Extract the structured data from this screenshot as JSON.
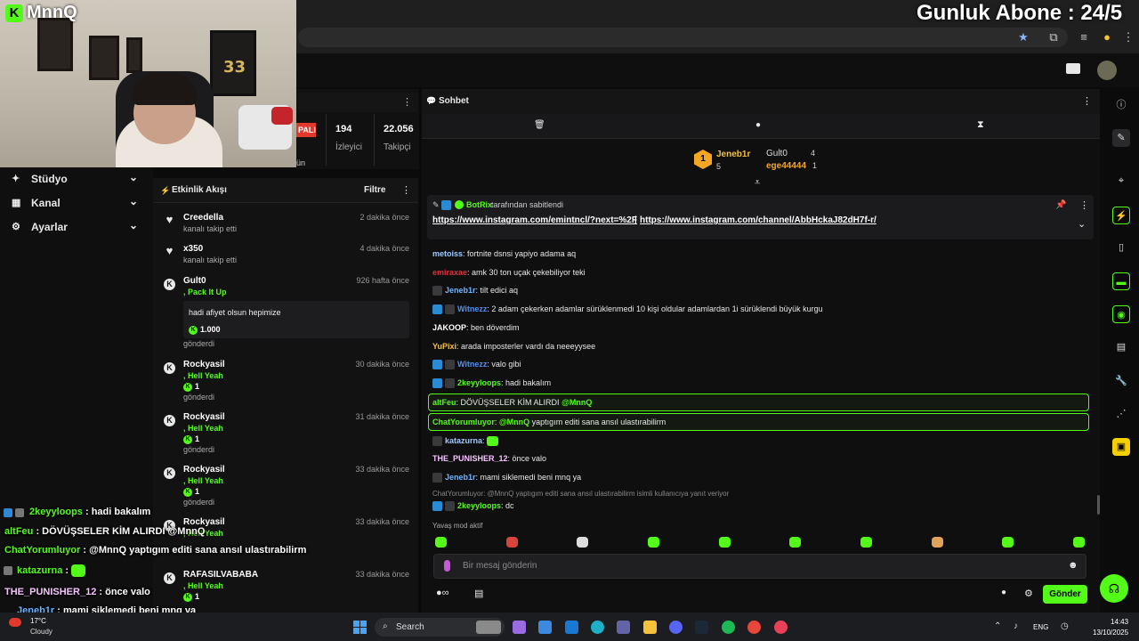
{
  "overlay": {
    "logo_letter": "K",
    "logo_text": "MnnQ",
    "daily_subs": "Gunluk Abone : 24/5",
    "jersey_number": "33"
  },
  "sidebar": {
    "items": [
      {
        "label": "Stüdyo"
      },
      {
        "label": "Kanal"
      },
      {
        "label": "Ayarlar"
      }
    ]
  },
  "stats": {
    "live": "PALI",
    "viewers": "194",
    "viewers_label": "İzleyici",
    "followers": "22.056",
    "followers_label": "Takipçi",
    "partial_a": "Program",
    "partial_b": "ün"
  },
  "feed": {
    "title": "Etkinlik Akışı",
    "filter": "Filtre",
    "items": [
      {
        "name": "Creedella",
        "sub": "kanalı takip etti",
        "time": "2 dakika önce"
      },
      {
        "name": "x350",
        "sub": "kanalı takip etti",
        "time": "4 dakika önce"
      },
      {
        "name": "Gult0",
        "green": ", Pack It Up",
        "message": "hadi afiyet olsun hepimize",
        "amount": "1.000",
        "sent": "gönderdi",
        "time": "926 hafta önce"
      },
      {
        "name": "Rockyasil",
        "green": ", Hell Yeah",
        "amount": "1",
        "sent": "gönderdi",
        "time": "30 dakika önce"
      },
      {
        "name": "Rockyasil",
        "green": ", Hell Yeah",
        "amount": "1",
        "sent": "gönderdi",
        "time": "31 dakika önce"
      },
      {
        "name": "Rockyasil",
        "green": ", Hell Yeah",
        "amount": "1",
        "sent": "gönderdi",
        "time": "33 dakika önce"
      },
      {
        "name": "Rockyasil",
        "green": ", Hell Yeah",
        "time": "33 dakika önce"
      },
      {
        "name": "RAFASILVABABA",
        "green": ", Hell Yeah",
        "amount": "1",
        "time": "33 dakika önce"
      }
    ]
  },
  "chat": {
    "title": "Sohbet",
    "leaderboard": {
      "first_rank": "1",
      "first_name": "Jeneb1r",
      "first_count": "5",
      "second_name": "Gult0",
      "second_count": "4",
      "third_name": "ege44444",
      "third_count": "1"
    },
    "pinned": {
      "by_user": "BotRix",
      "by_text": "tarafından sabitlendi",
      "link1": "https://www.instagram.com/emintncl/?next=%2F",
      "sep": "|",
      "link2": "https://www.instagram.com/channel/AbbHckaJ82dH7f-r/"
    },
    "messages": [
      {
        "user": "metoiss",
        "text": ": fortnite dsnsi yapiyo adama aq",
        "color": "#9ec9ff"
      },
      {
        "user": "emiraxae",
        "text": ": amk 30 ton uçak çekebiliyor teki",
        "color": "#e0313a"
      },
      {
        "user": "Jeneb1r",
        "text": ": tilt edici aq",
        "color": "#6fb4ff"
      },
      {
        "user": "Witnezz",
        "text": ": 2 adam çekerken adamlar sürüklenmedi 10 kişi oldular adamlardan 1i sürüklendi büyük kurgu",
        "color": "#4f8ef7"
      },
      {
        "user": "JAKOOP",
        "text": ": ben döverdim",
        "color": "#ffffff"
      },
      {
        "user": "YuPixi",
        "text": ": arada imposterler vardı da neeeyysee",
        "color": "#f5c13a"
      },
      {
        "user": "Witnezz",
        "text": ": valo gibi",
        "color": "#4f8ef7"
      },
      {
        "user": "2keyyloops",
        "text": ": hadi bakalım",
        "color": "#53fc18"
      },
      {
        "user": "altFeu",
        "text": ": DÖVÜŞSELER KİM ALIRDI",
        "mention": "@MnnQ",
        "color": "#53fc18"
      },
      {
        "user": "ChatYorumluyor",
        "text": ":",
        "mention": "@MnnQ",
        "text2": "yaptıgım editi sana ansıl ulastırabilirm",
        "color": "#53fc18"
      },
      {
        "user": "katazurna",
        "text": ":",
        "color": "#9ec9ff"
      },
      {
        "user": "THE_PUNISHER_12",
        "text": ": önce valo",
        "color": "#f7c4ff"
      },
      {
        "user": "Jeneb1r",
        "text": ": mami siklemedi beni mnq ya",
        "color": "#6fb4ff"
      },
      {
        "user": "2keyyloops",
        "text": ": dc",
        "color": "#53fc18"
      }
    ],
    "reply_note": "ChatYorumluyor: @MnnQ yaptıgım editi sana ansıl ulastırabilirm isimli kullanıcıya yanıt veriyor",
    "slow_mode": "Yavaş mod aktif",
    "input_placeholder": "Bir mesaj gönderin",
    "send_label": "Gönder",
    "partial_top": "… … …"
  },
  "overlay_chat": [
    {
      "user": "2keyyloops",
      "text": " : hadi bakalım",
      "color": "#53fc18"
    },
    {
      "user": "altFeu",
      "text": " : DÖVÜŞSELER KİM ALIRDI @MnnQ",
      "color": "#53fc18"
    },
    {
      "user": "ChatYorumluyor",
      "text": " : @MnnQ yaptıgım editi sana ansıl ulastırabilirm",
      "color": "#53fc18"
    },
    {
      "user": "katazurna",
      "text": " :",
      "color": "#53fc18"
    },
    {
      "user": "THE_PUNISHER_12",
      "text": " : önce valo",
      "color": "#f7c4ff"
    },
    {
      "user": "Jeneb1r",
      "text": " : mami siklemedi beni mnq ya",
      "color": "#6fb4ff"
    }
  ],
  "taskbar": {
    "weather_temp": "17°C",
    "weather_text": "Cloudy",
    "search": "Search",
    "lang": "ENG",
    "time": "14:43",
    "date": "13/10/2025"
  },
  "colors": {
    "accent": "#53fc18",
    "live": "#e2392d"
  }
}
